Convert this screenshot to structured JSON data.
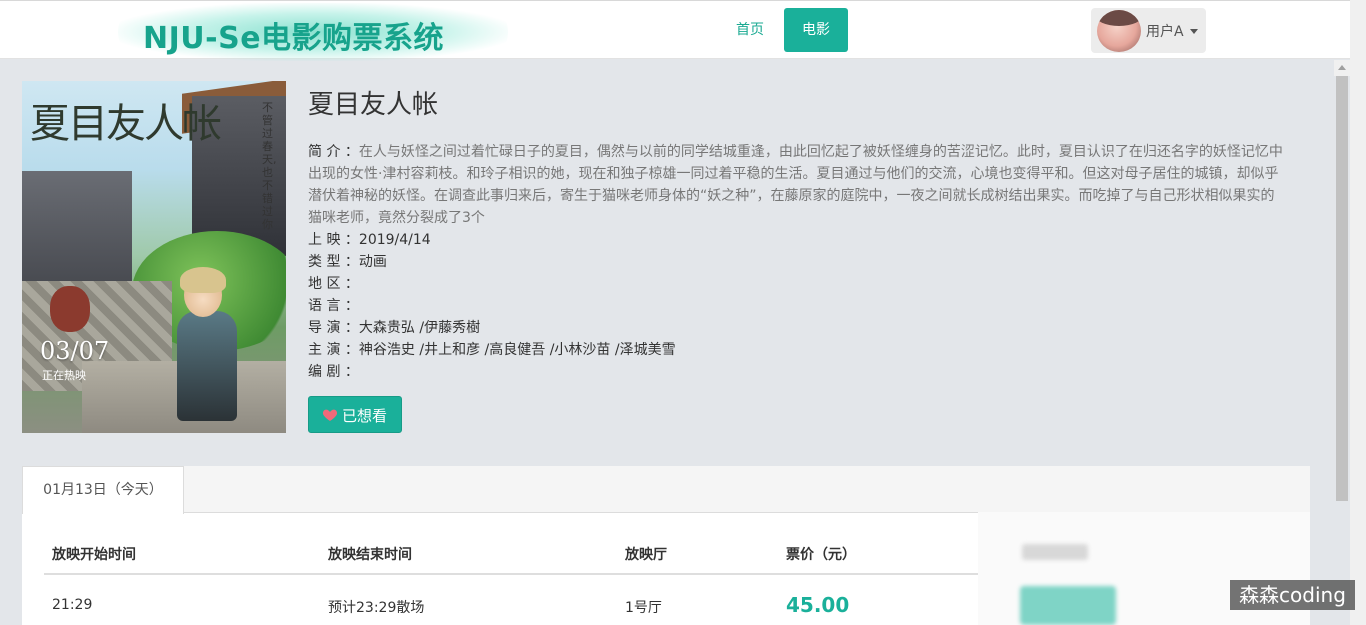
{
  "header": {
    "logo": "NJU-Se电影购票系统",
    "nav": {
      "home": "首页",
      "movie": "电影"
    },
    "user": {
      "name": "用户A"
    }
  },
  "movie": {
    "title": "夏目友人帐",
    "poster": {
      "title": "夏目友人帐",
      "vertical_text": "不管过春天,也不错过你",
      "date": "03/07",
      "showing": "正在热映"
    },
    "fields": [
      {
        "label": "简 介 ：",
        "value": "在人与妖怪之间过着忙碌日子的夏目，偶然与以前的同学结城重逢，由此回忆起了被妖怪缠身的苦涩记忆。此时，夏目认识了在归还名字的妖怪记忆中出现的女性·津村容莉枝。和玲子相识的她，现在和独子椋雄一同过着平稳的生活。夏目通过与他们的交流，心境也变得平和。但这对母子居住的城镇，却似乎潜伏着神秘的妖怪。在调查此事归来后，寄生于猫咪老师身体的“妖之种”，在藤原家的庭院中，一夜之间就长成树结出果实。而吃掉了与自己形状相似果实的猫咪老师，竟然分裂成了3个"
      },
      {
        "label": "上 映 ：",
        "value": "2019/4/14"
      },
      {
        "label": "类 型 ：",
        "value": "动画"
      },
      {
        "label": "地 区 ：",
        "value": ""
      },
      {
        "label": "语 言 ：",
        "value": ""
      },
      {
        "label": "导 演 ：",
        "value": "大森贵弘 /伊藤秀樹"
      },
      {
        "label": "主 演 ：",
        "value": "神谷浩史 /井上和彦 /高良健吾 /小林沙苗 /泽城美雪"
      },
      {
        "label": "编 剧 ：",
        "value": ""
      }
    ],
    "like_button": "已想看"
  },
  "schedule": {
    "tab": "01月13日（今天）",
    "columns": [
      "放映开始时间",
      "放映结束时间",
      "放映厅",
      "票价（元）"
    ],
    "rows": [
      {
        "start": "21:29",
        "end": "预计23:29散场",
        "hall": "1号厅",
        "price": "45.00"
      }
    ]
  },
  "watermark": "森森coding",
  "colors": {
    "accent": "#1ab09a",
    "background": "#e3e6ea"
  }
}
